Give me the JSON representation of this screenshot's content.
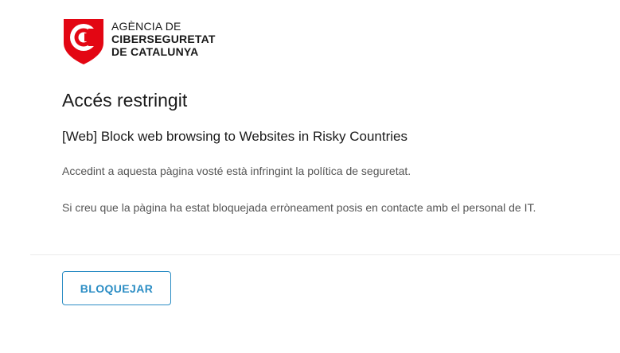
{
  "brand": {
    "line1": "AGÈNCIA DE",
    "line2": "CIBERSEGURETAT",
    "line3": "DE CATALUNYA",
    "logo_icon": "shield-c-logo-icon",
    "logo_color": "#e30613"
  },
  "page": {
    "title": "Accés restringit",
    "policy": "[Web] Block web browsing to Websites in Risky Countries",
    "message_1": "Accedint a aquesta pàgina vosté està infringint la política de seguretat.",
    "message_2": "Si creu que la pàgina ha estat bloquejada erròneament posis en contacte amb el personal de IT."
  },
  "actions": {
    "block_label": "BLOQUEJAR",
    "accent_color": "#2b8dc4"
  }
}
